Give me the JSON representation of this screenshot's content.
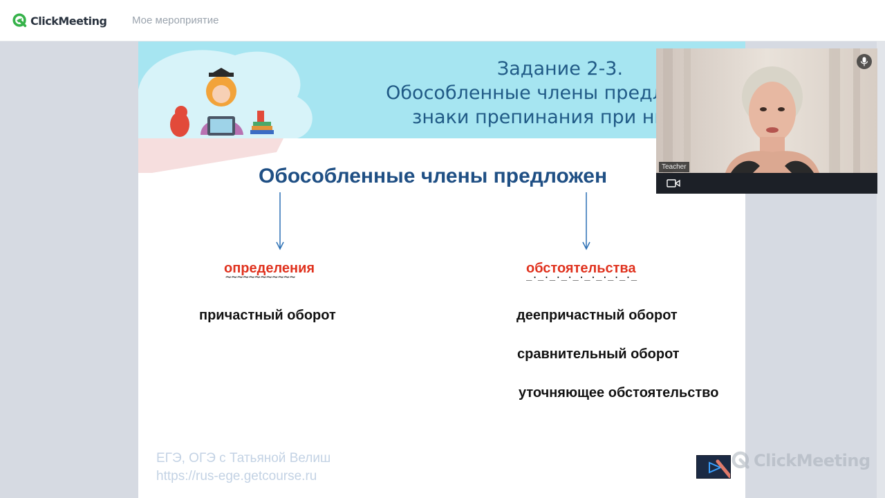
{
  "app": {
    "brand_name": "ClickMeeting",
    "event_title": "Мое мероприятие",
    "brand_color": "#36b24a"
  },
  "slide": {
    "title_lines": [
      "Задание 2-3.",
      "Обособленные члены предлож",
      "знаки препинания при ни"
    ],
    "main_heading": "Обособленные члены предложен",
    "columns": [
      {
        "label": "определения",
        "underline": "~~~~~~~~~~~~",
        "items": [
          "причастный оборот"
        ]
      },
      {
        "label": "обстоятельства",
        "underline": "_._._._._._._._._._",
        "items": [
          "деепричастный оборот",
          "сравнительный оборот",
          "уточняющее обстоятельство"
        ]
      }
    ],
    "watermark_lines": [
      "ЕГЭ, ОГЭ с Татьяной Велиш",
      "https://rus-ege.getcourse.ru"
    ],
    "corner_brand": "ClickMeeting"
  },
  "video": {
    "presenter_label": "Teacher",
    "icons": [
      "microphone-icon",
      "camera-icon"
    ]
  }
}
